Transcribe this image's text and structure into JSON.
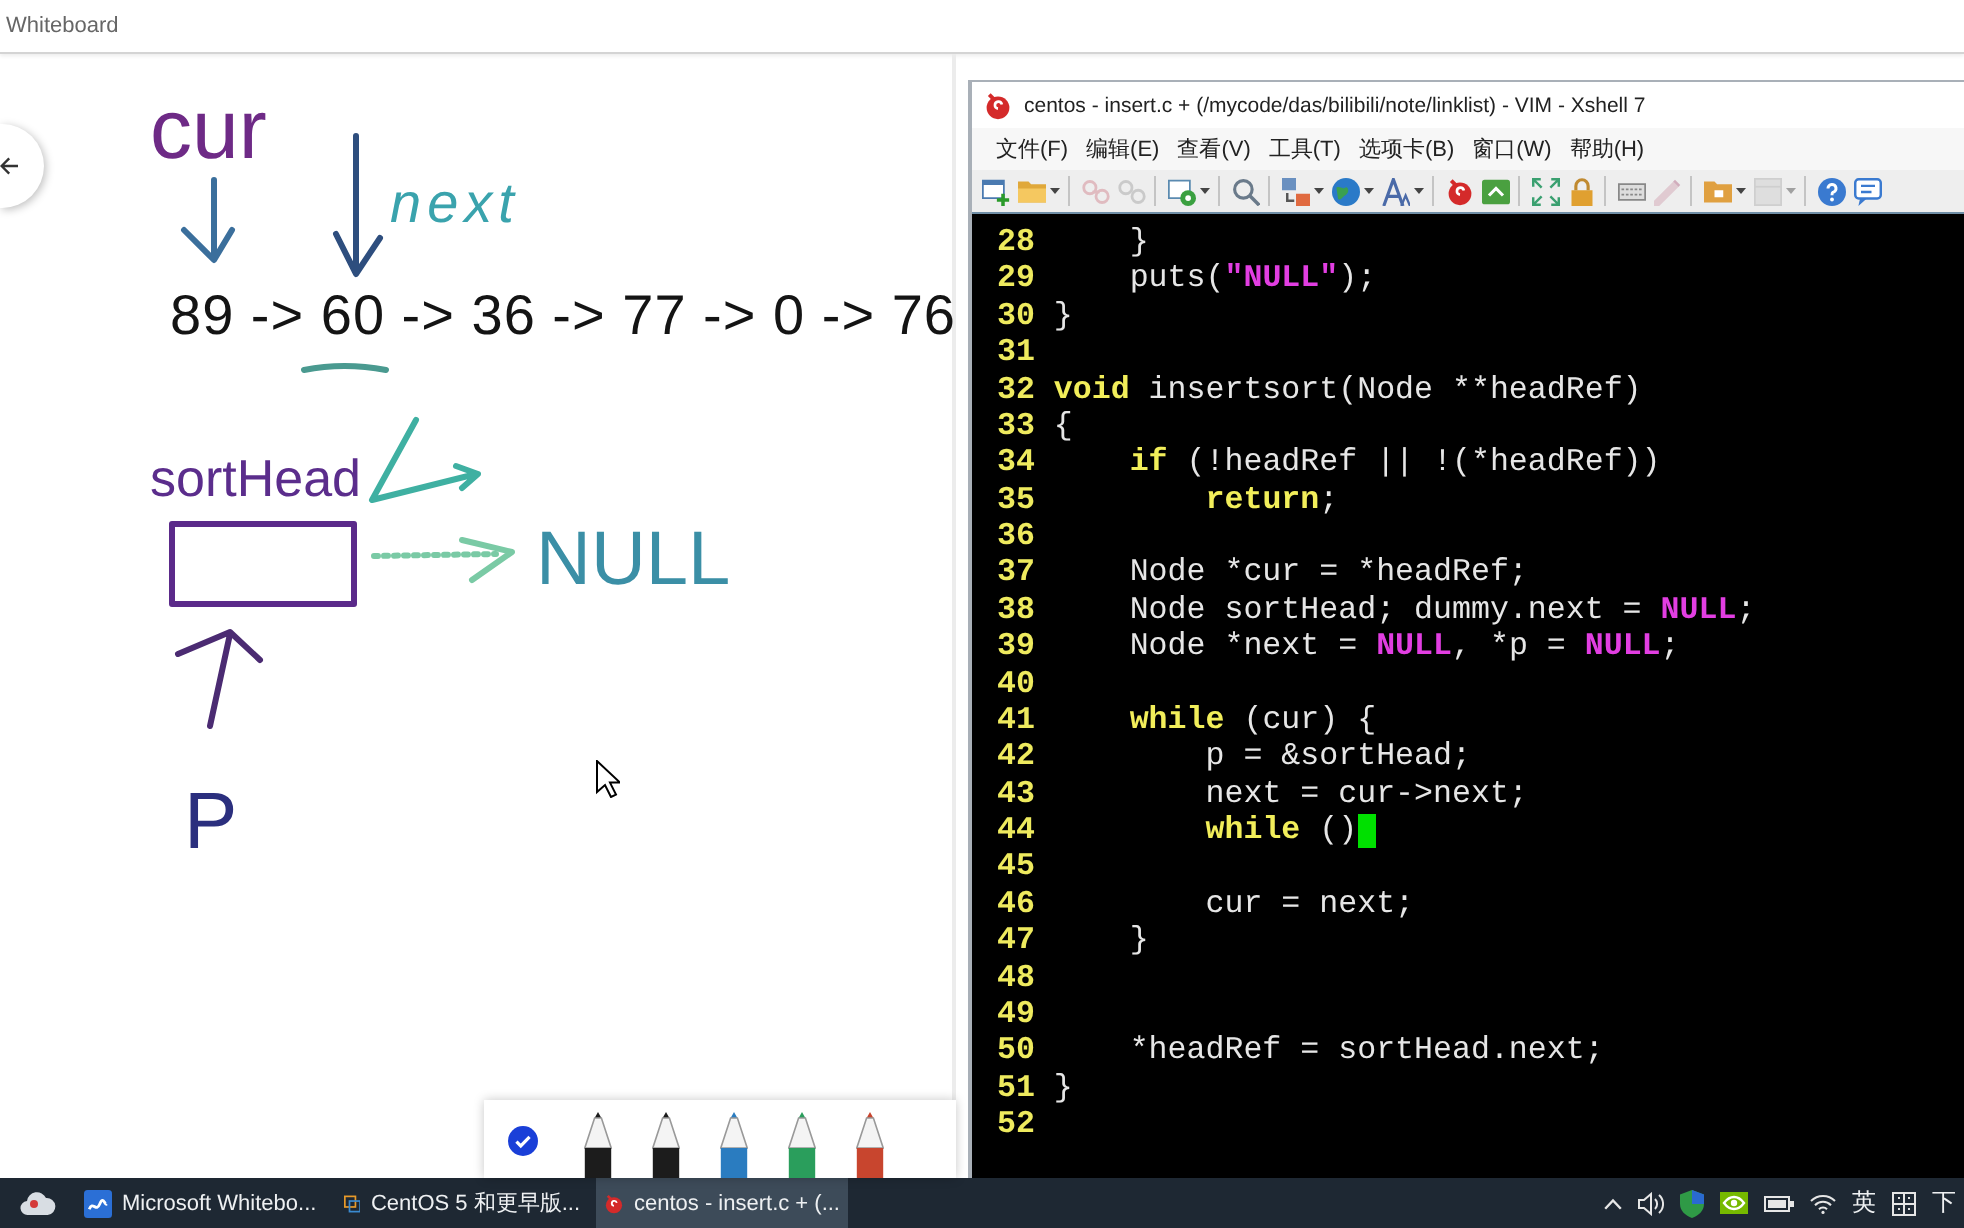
{
  "whiteboard": {
    "title": "Whiteboard",
    "ink": [
      {
        "text": "cur",
        "color": "#6e2a86"
      },
      {
        "text": "next",
        "color": "#3aa3ad"
      },
      {
        "text": "89 -> 60 -> 36 -> 77 -> 0 -> 76",
        "color": "#141414"
      },
      {
        "text": "sortHead",
        "color": "#5b2d8c"
      },
      {
        "text": "NULL",
        "color": "#3b8fa6"
      },
      {
        "text": "P",
        "color": "#2b2f7e"
      }
    ],
    "pens": [
      {
        "color": "#1c1c1c"
      },
      {
        "color": "#1c1c1c"
      },
      {
        "color": "#2a7cc0"
      },
      {
        "color": "#2a9e5c"
      },
      {
        "color": "#c8452e"
      }
    ]
  },
  "terminal_window": {
    "title": "centos - insert.c + (/mycode/das/bilibili/note/linklist) - VIM - Xshell 7",
    "menu": [
      "文件(F)",
      "编辑(E)",
      "查看(V)",
      "工具(T)",
      "选项卡(B)",
      "窗口(W)",
      "帮助(H)"
    ],
    "toolbar_groups": [
      {
        "items": [
          {
            "kind": "new",
            "dropdown": false,
            "disabled": false
          },
          {
            "kind": "open",
            "dropdown": true,
            "disabled": false
          }
        ]
      },
      {
        "items": [
          {
            "kind": "link",
            "dropdown": false,
            "disabled": true
          },
          {
            "kind": "unlink",
            "dropdown": false,
            "disabled": true
          }
        ]
      },
      {
        "items": [
          {
            "kind": "screen",
            "dropdown": true,
            "disabled": false
          }
        ]
      },
      {
        "items": [
          {
            "kind": "search",
            "dropdown": false,
            "disabled": false
          }
        ]
      },
      {
        "items": [
          {
            "kind": "transfer",
            "dropdown": true,
            "disabled": false
          },
          {
            "kind": "globe",
            "dropdown": true,
            "disabled": false
          },
          {
            "kind": "font",
            "dropdown": true,
            "disabled": false
          }
        ]
      },
      {
        "items": [
          {
            "kind": "swirl",
            "dropdown": false,
            "disabled": false
          },
          {
            "kind": "share",
            "dropdown": false,
            "disabled": false
          }
        ]
      },
      {
        "items": [
          {
            "kind": "expand",
            "dropdown": false,
            "disabled": false
          },
          {
            "kind": "lock",
            "dropdown": false,
            "disabled": false
          }
        ]
      },
      {
        "items": [
          {
            "kind": "keyboard",
            "dropdown": false,
            "disabled": false
          },
          {
            "kind": "pen",
            "dropdown": false,
            "disabled": true
          }
        ]
      },
      {
        "items": [
          {
            "kind": "folder",
            "dropdown": true,
            "disabled": false
          },
          {
            "kind": "panel",
            "dropdown": true,
            "disabled": true
          }
        ]
      },
      {
        "items": [
          {
            "kind": "help",
            "dropdown": false,
            "disabled": false
          },
          {
            "kind": "chat",
            "dropdown": false,
            "disabled": false
          }
        ]
      }
    ],
    "lines": [
      {
        "number": "28",
        "cursor": false,
        "tokens": [
          {
            "kind": "plain",
            "text": "    }"
          }
        ]
      },
      {
        "number": "29",
        "cursor": false,
        "tokens": [
          {
            "kind": "plain",
            "text": "    puts("
          },
          {
            "kind": "string",
            "text": "\"NULL\""
          },
          {
            "kind": "plain",
            "text": ");"
          }
        ]
      },
      {
        "number": "30",
        "cursor": false,
        "tokens": [
          {
            "kind": "plain",
            "text": "}"
          }
        ]
      },
      {
        "number": "31",
        "cursor": false
      },
      {
        "number": "32",
        "cursor": false,
        "tokens": [
          {
            "kind": "keyword",
            "text": "void"
          },
          {
            "kind": "plain",
            "text": " insertsort(Node **headRef)"
          }
        ]
      },
      {
        "number": "33",
        "cursor": false,
        "tokens": [
          {
            "kind": "plain",
            "text": "{"
          }
        ]
      },
      {
        "number": "34",
        "cursor": false,
        "tokens": [
          {
            "kind": "keyword",
            "text": "    if"
          },
          {
            "kind": "plain",
            "text": " (!headRef || !(*headRef))"
          }
        ]
      },
      {
        "number": "35",
        "cursor": false,
        "tokens": [
          {
            "kind": "keyword",
            "text": "        return"
          },
          {
            "kind": "plain",
            "text": ";"
          }
        ]
      },
      {
        "number": "36",
        "cursor": false
      },
      {
        "number": "37",
        "cursor": false,
        "tokens": [
          {
            "kind": "plain",
            "text": "    Node *cur = *headRef;"
          }
        ]
      },
      {
        "number": "38",
        "cursor": false,
        "tokens": [
          {
            "kind": "plain",
            "text": "    Node sortHead; dummy.next = "
          },
          {
            "kind": "constant",
            "text": "NULL"
          },
          {
            "kind": "plain",
            "text": ";"
          }
        ]
      },
      {
        "number": "39",
        "cursor": false,
        "tokens": [
          {
            "kind": "plain",
            "text": "    Node *next = "
          },
          {
            "kind": "constant",
            "text": "NULL"
          },
          {
            "kind": "plain",
            "text": ", *p = "
          },
          {
            "kind": "constant",
            "text": "NULL"
          },
          {
            "kind": "plain",
            "text": ";"
          }
        ]
      },
      {
        "number": "40",
        "cursor": false
      },
      {
        "number": "41",
        "cursor": false,
        "tokens": [
          {
            "kind": "keyword",
            "text": "    while"
          },
          {
            "kind": "plain",
            "text": " (cur) {"
          }
        ]
      },
      {
        "number": "42",
        "cursor": false,
        "tokens": [
          {
            "kind": "plain",
            "text": "        p = &sortHead;"
          }
        ]
      },
      {
        "number": "43",
        "cursor": false,
        "tokens": [
          {
            "kind": "plain",
            "text": "        next = cur->next;"
          }
        ]
      },
      {
        "number": "44",
        "cursor": true,
        "tokens": [
          {
            "kind": "keyword",
            "text": "        while"
          },
          {
            "kind": "plain",
            "text": " ()"
          }
        ]
      },
      {
        "number": "45",
        "cursor": false
      },
      {
        "number": "46",
        "cursor": false,
        "tokens": [
          {
            "kind": "plain",
            "text": "        cur = next;"
          }
        ]
      },
      {
        "number": "47",
        "cursor": false,
        "tokens": [
          {
            "kind": "plain",
            "text": "    }"
          }
        ]
      },
      {
        "number": "48",
        "cursor": false
      },
      {
        "number": "49",
        "cursor": false
      },
      {
        "number": "50",
        "cursor": false,
        "tokens": [
          {
            "kind": "plain",
            "text": "    *headRef = sortHead.next;"
          }
        ]
      },
      {
        "number": "51",
        "cursor": false,
        "tokens": [
          {
            "kind": "plain",
            "text": "}"
          }
        ]
      },
      {
        "number": "52",
        "cursor": false
      }
    ]
  },
  "taskbar": {
    "apps": [
      {
        "kind": "board",
        "label": "Microsoft Whitebo...",
        "selected": false
      },
      {
        "kind": "squares",
        "label": "CentOS 5 和更早版...",
        "selected": false
      },
      {
        "kind": "swirl",
        "label": "centos - insert.c + (...",
        "selected": true
      }
    ],
    "input_language": "英",
    "clock": "下"
  }
}
